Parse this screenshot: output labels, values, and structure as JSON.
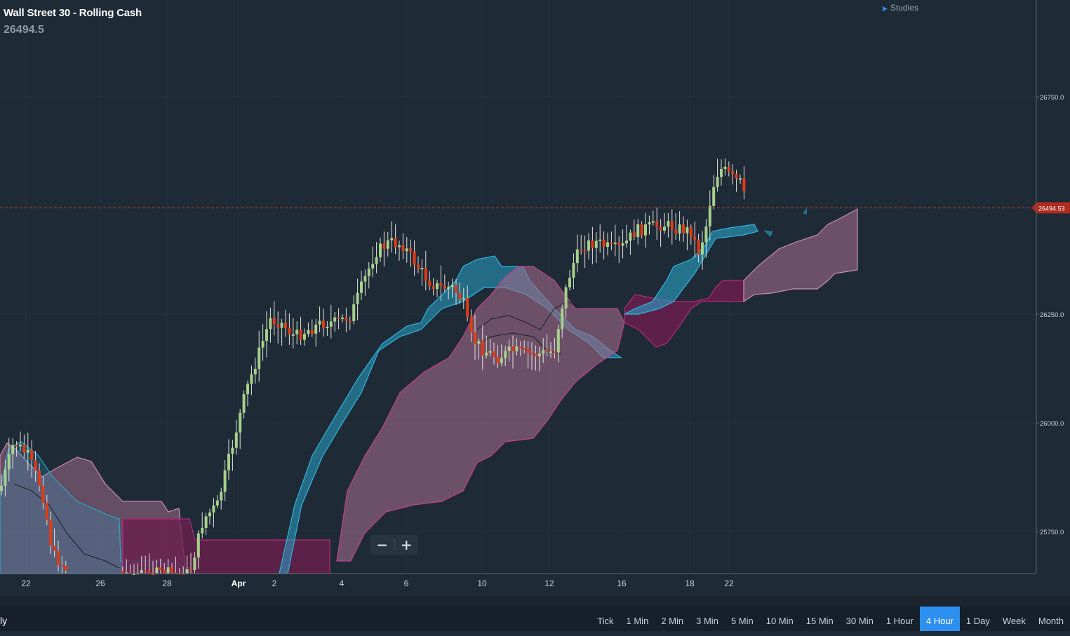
{
  "header": {
    "instrument": "Wall Street 30 - Rolling Cash",
    "last_price": "26494.5",
    "studies_label": "Studies"
  },
  "zoom": {
    "minus": "−",
    "plus": "+"
  },
  "bottom": {
    "left_label": "ly",
    "timeframes": [
      "Tick",
      "1 Min",
      "2 Min",
      "3 Min",
      "5 Min",
      "10 Min",
      "15 Min",
      "30 Min",
      "1 Hour",
      "4 Hour",
      "1 Day",
      "Week",
      "Month"
    ],
    "active_timeframe": "4 Hour"
  },
  "colors": {
    "background": "#1e2a36",
    "bull": "#a6d08a",
    "bear": "#e03b17",
    "cloud_bull": "#2aa3c8",
    "cloud_bear": "#a06a8a",
    "price_line": "#c23a2a",
    "accent": "#2d8ff0"
  },
  "chart_data": {
    "type": "candlestick",
    "instrument": "Wall Street 30 - Rolling Cash",
    "timeframe": "4 Hour",
    "y_ticks": [
      26750.0,
      26250.0,
      26000.0,
      25750.0
    ],
    "y_tick_labels": [
      "26750.0",
      "26250.0",
      "26000.0",
      "25750.0"
    ],
    "x_tick_labels": [
      "22",
      "26",
      "28",
      "Apr",
      "2",
      "4",
      "6",
      "10",
      "12",
      "16",
      "18",
      "22"
    ],
    "current_price": 26494.53,
    "current_price_label": "26494.53",
    "indicator": "Ichimoku Cloud"
  }
}
